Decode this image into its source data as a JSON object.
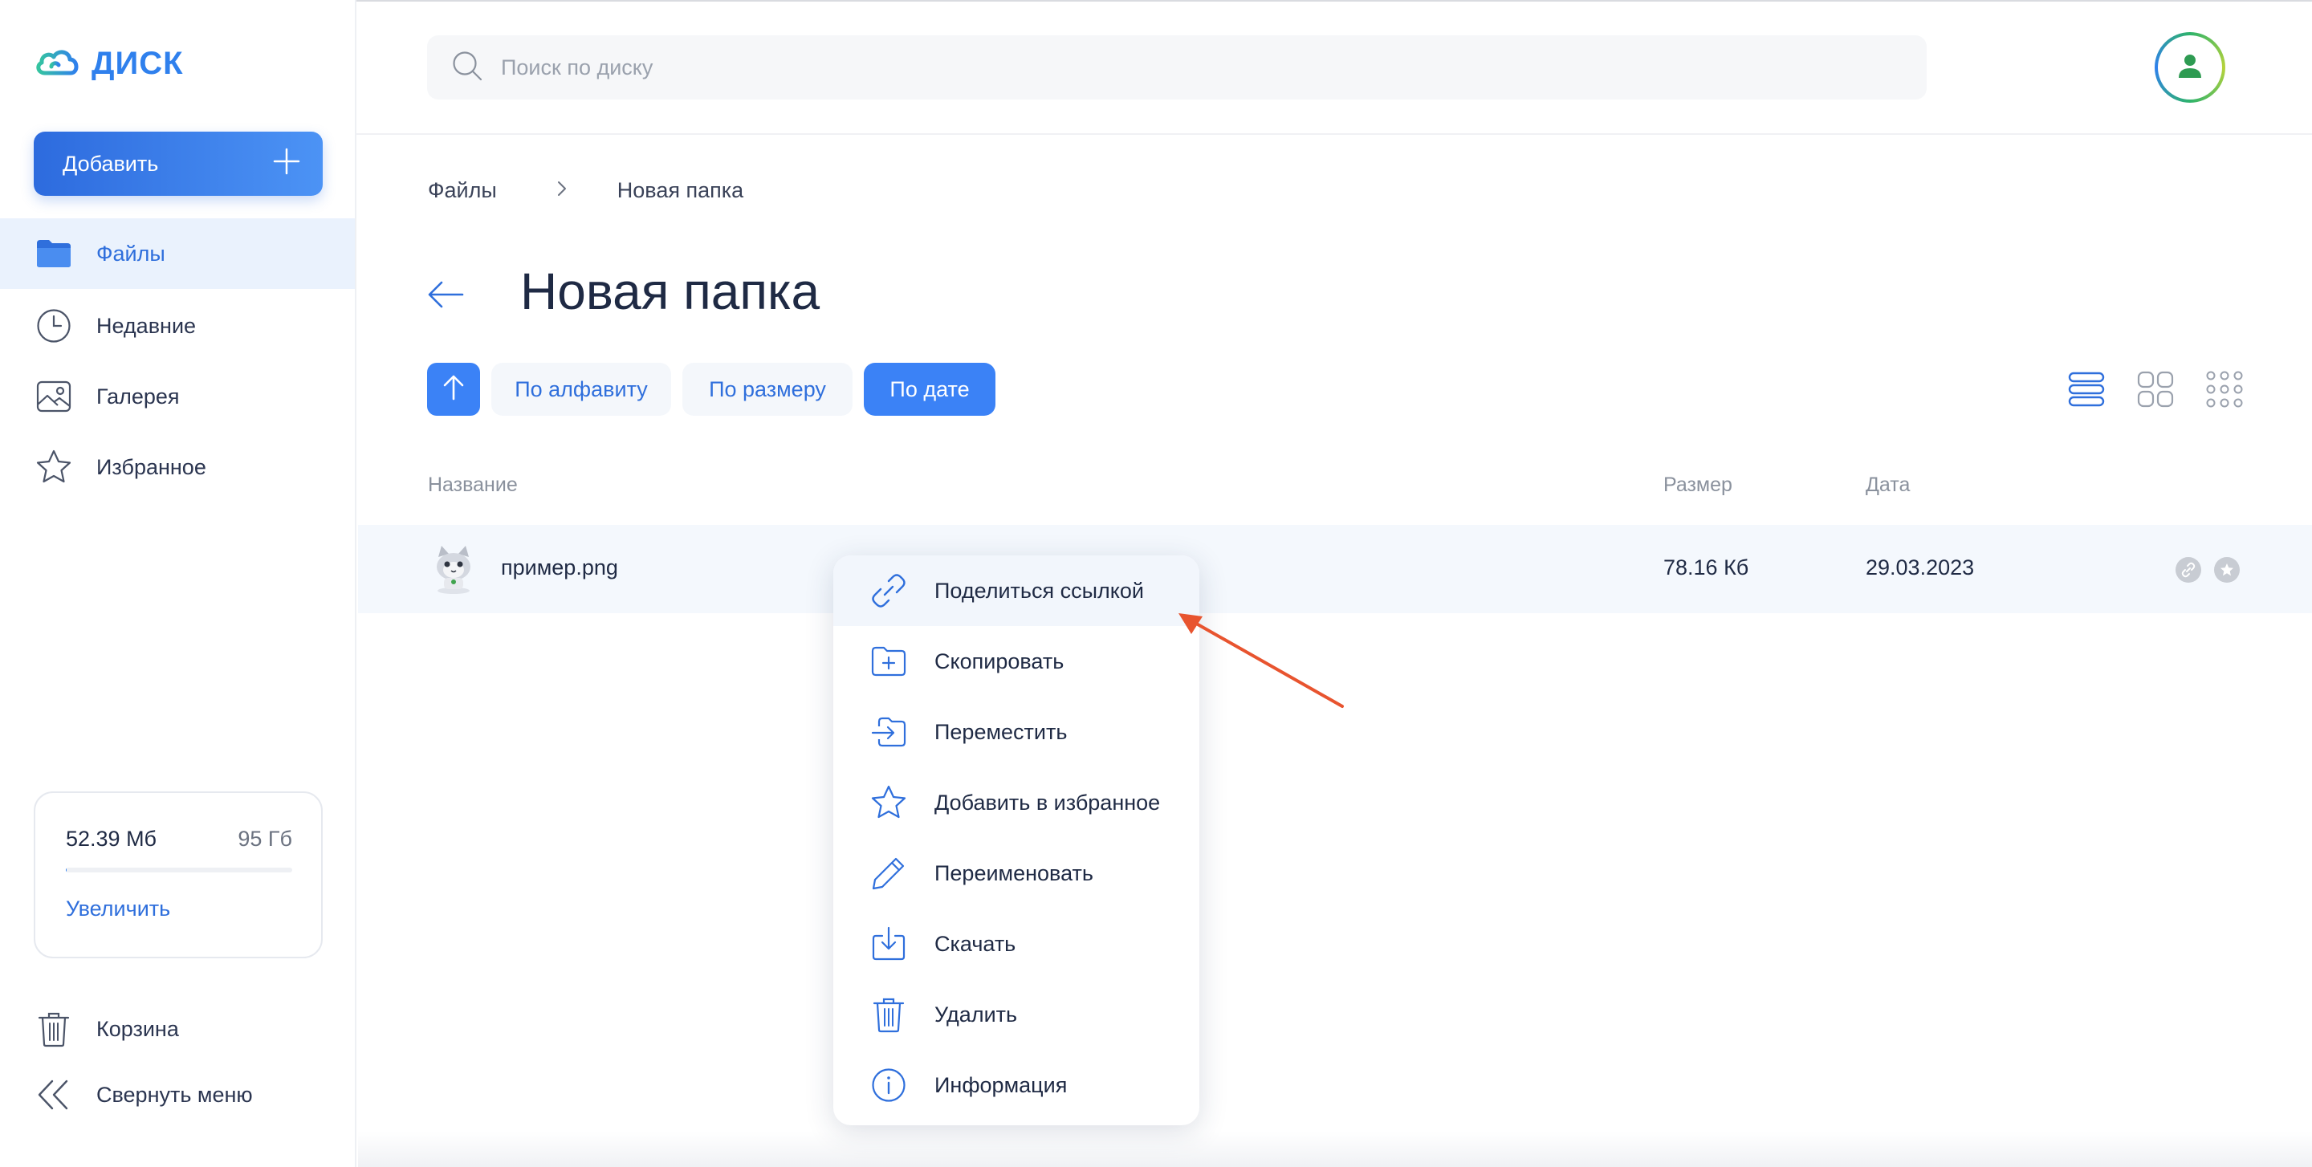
{
  "app": {
    "logo_text": "ДИСК",
    "brand_color": "#2f80ed"
  },
  "sidebar": {
    "add_label": "Добавить",
    "items": [
      {
        "label": "Файлы",
        "icon": "folder-icon",
        "active": true
      },
      {
        "label": "Недавние",
        "icon": "clock-icon",
        "active": false
      },
      {
        "label": "Галерея",
        "icon": "gallery-icon",
        "active": false
      },
      {
        "label": "Избранное",
        "icon": "star-icon",
        "active": false
      }
    ],
    "storage": {
      "used": "52.39 Мб",
      "total": "95 Гб",
      "upgrade_label": "Увеличить",
      "fill_fraction": 0.0005
    },
    "bottom_items": [
      {
        "label": "Корзина",
        "icon": "trash-icon"
      },
      {
        "label": "Свернуть меню",
        "icon": "collapse-icon"
      }
    ]
  },
  "header": {
    "search_placeholder": "Поиск по диску",
    "search_value": ""
  },
  "breadcrumb": [
    "Файлы",
    "Новая папка"
  ],
  "page_title": "Новая папка",
  "sort": {
    "direction": "ascending",
    "options": [
      {
        "label": "По алфавиту",
        "active": false
      },
      {
        "label": "По размеру",
        "active": false
      },
      {
        "label": "По дате",
        "active": true
      }
    ]
  },
  "view_modes": [
    "list-view-icon",
    "grid-view-icon",
    "small-grid-view-icon"
  ],
  "table": {
    "columns": [
      "Название",
      "Размер",
      "Дата"
    ],
    "rows": [
      {
        "name": "пример.png",
        "size": "78.16 Кб",
        "date": "29.03.2023"
      }
    ]
  },
  "context_menu": {
    "items": [
      {
        "label": "Поделиться ссылкой",
        "icon": "link-icon"
      },
      {
        "label": "Скопировать",
        "icon": "folder-plus-icon"
      },
      {
        "label": "Переместить",
        "icon": "move-icon"
      },
      {
        "label": "Добавить в избранное",
        "icon": "star-icon"
      },
      {
        "label": "Переименовать",
        "icon": "pencil-icon"
      },
      {
        "label": "Скачать",
        "icon": "download-icon"
      },
      {
        "label": "Удалить",
        "icon": "trash-icon"
      },
      {
        "label": "Информация",
        "icon": "info-icon"
      }
    ]
  },
  "colors": {
    "accent": "#3b82f6",
    "annotation_arrow": "#e8542f"
  }
}
